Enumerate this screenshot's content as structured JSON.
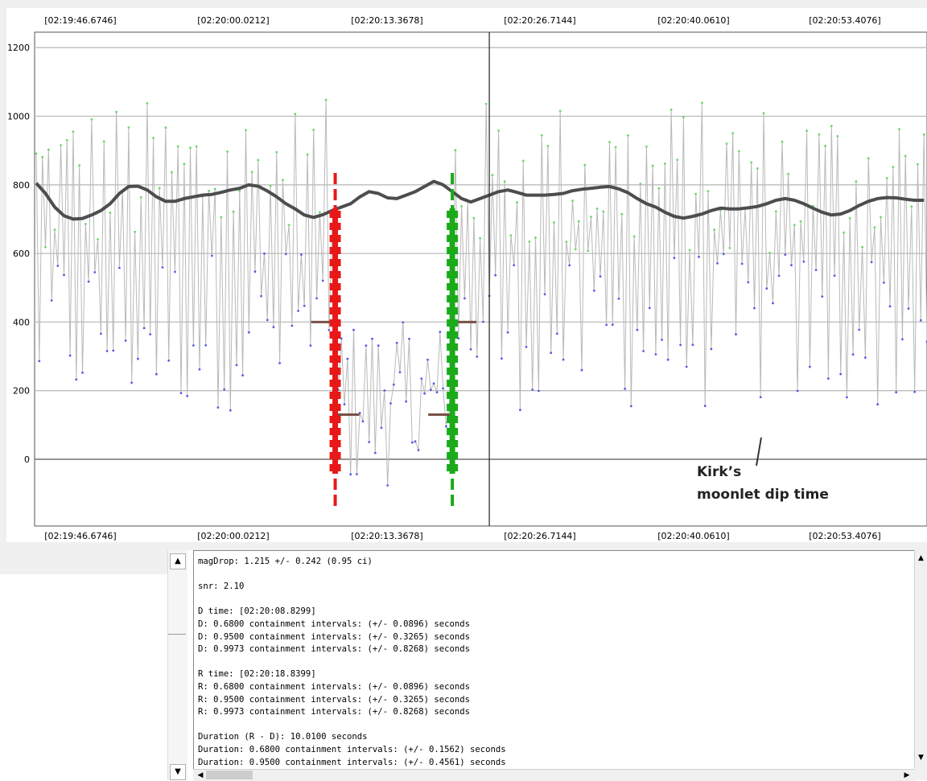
{
  "chart_data": {
    "type": "scatter",
    "x_ticks": [
      "[02:19:46.6746]",
      "[02:20:00.0212]",
      "[02:20:13.3678]",
      "[02:20:26.7144]",
      "[02:20:40.0610]",
      "[02:20:53.4076]"
    ],
    "y_ticks": [
      "1200",
      "1000",
      "800",
      "600",
      "400",
      "200",
      "0"
    ],
    "ylim": [
      -150,
      1250
    ],
    "grid": true,
    "series": [
      {
        "color": "#6ad66a",
        "values_level": "upper band ~650-1100"
      },
      {
        "color": "#5a5ae6",
        "values_level": "lower band ~100-600"
      }
    ],
    "smoothed_line": {
      "color": "#4d4d4d",
      "points": [
        [
          0,
          805
        ],
        [
          3,
          775
        ],
        [
          6,
          735
        ],
        [
          9,
          710
        ],
        [
          12,
          700
        ],
        [
          15,
          702
        ],
        [
          18,
          712
        ],
        [
          21,
          725
        ],
        [
          24,
          745
        ],
        [
          27,
          775
        ],
        [
          30,
          795
        ],
        [
          33,
          796
        ],
        [
          36,
          785
        ],
        [
          39,
          765
        ],
        [
          42,
          752
        ],
        [
          45,
          752
        ],
        [
          48,
          760
        ],
        [
          51,
          765
        ],
        [
          54,
          770
        ],
        [
          57,
          772
        ],
        [
          60,
          778
        ],
        [
          63,
          785
        ],
        [
          66,
          790
        ],
        [
          69,
          800
        ],
        [
          72,
          796
        ],
        [
          75,
          782
        ],
        [
          78,
          765
        ],
        [
          81,
          745
        ],
        [
          84,
          730
        ],
        [
          87,
          712
        ],
        [
          90,
          705
        ],
        [
          93,
          713
        ],
        [
          96,
          725
        ],
        [
          99,
          735
        ],
        [
          102,
          745
        ],
        [
          105,
          765
        ],
        [
          108,
          780
        ],
        [
          111,
          775
        ],
        [
          114,
          762
        ],
        [
          117,
          760
        ],
        [
          120,
          770
        ],
        [
          123,
          780
        ],
        [
          126,
          795
        ],
        [
          129,
          810
        ],
        [
          132,
          800
        ],
        [
          135,
          780
        ],
        [
          138,
          760
        ],
        [
          141,
          750
        ],
        [
          144,
          760
        ],
        [
          147,
          770
        ],
        [
          150,
          780
        ],
        [
          153,
          785
        ],
        [
          156,
          778
        ],
        [
          159,
          770
        ],
        [
          162,
          770
        ],
        [
          165,
          770
        ],
        [
          168,
          772
        ],
        [
          171,
          775
        ],
        [
          174,
          783
        ],
        [
          177,
          787
        ],
        [
          180,
          790
        ],
        [
          183,
          793
        ],
        [
          186,
          795
        ],
        [
          189,
          788
        ],
        [
          192,
          777
        ],
        [
          195,
          760
        ],
        [
          198,
          745
        ],
        [
          201,
          735
        ],
        [
          204,
          720
        ],
        [
          207,
          708
        ],
        [
          210,
          703
        ],
        [
          213,
          708
        ],
        [
          216,
          715
        ],
        [
          219,
          725
        ],
        [
          222,
          732
        ],
        [
          225,
          730
        ],
        [
          228,
          730
        ],
        [
          231,
          733
        ],
        [
          234,
          737
        ],
        [
          237,
          745
        ],
        [
          240,
          755
        ],
        [
          243,
          760
        ],
        [
          246,
          755
        ],
        [
          249,
          745
        ],
        [
          252,
          732
        ],
        [
          255,
          720
        ],
        [
          258,
          712
        ],
        [
          261,
          715
        ],
        [
          264,
          725
        ],
        [
          267,
          740
        ],
        [
          270,
          752
        ],
        [
          273,
          760
        ],
        [
          276,
          763
        ],
        [
          279,
          762
        ],
        [
          282,
          758
        ],
        [
          285,
          755
        ],
        [
          288,
          755
        ]
      ]
    },
    "baseline_level": 400,
    "event_level": 130,
    "d_marker": {
      "color": "#e81818",
      "time_index": 97
    },
    "r_marker": {
      "color": "#1aaa1a",
      "time_index": 135
    },
    "cursor_index": 147
  },
  "annotation": {
    "line1": "Kirk’s",
    "line2": "moonlet dip time"
  },
  "output_text": "magDrop: 1.215 +/- 0.242 (0.95 ci)\n\nsnr: 2.10\n\nD time: [02:20:08.8299]\nD: 0.6800 containment intervals: (+/- 0.0896) seconds\nD: 0.9500 containment intervals: (+/- 0.3265) seconds\nD: 0.9973 containment intervals: (+/- 0.8268) seconds\n\nR time: [02:20:18.8399]\nR: 0.6800 containment intervals: (+/- 0.0896) seconds\nR: 0.9500 containment intervals: (+/- 0.3265) seconds\nR: 0.9973 containment intervals: (+/- 0.8268) seconds\n\nDuration (R - D): 10.0100 seconds\nDuration: 0.6800 containment intervals: (+/- 0.1562) seconds\nDuration: 0.9500 containment intervals: (+/- 0.4561) seconds",
  "scroll_glyphs": {
    "up": "▲",
    "down": "▼",
    "left": "◀",
    "right": "▶"
  }
}
